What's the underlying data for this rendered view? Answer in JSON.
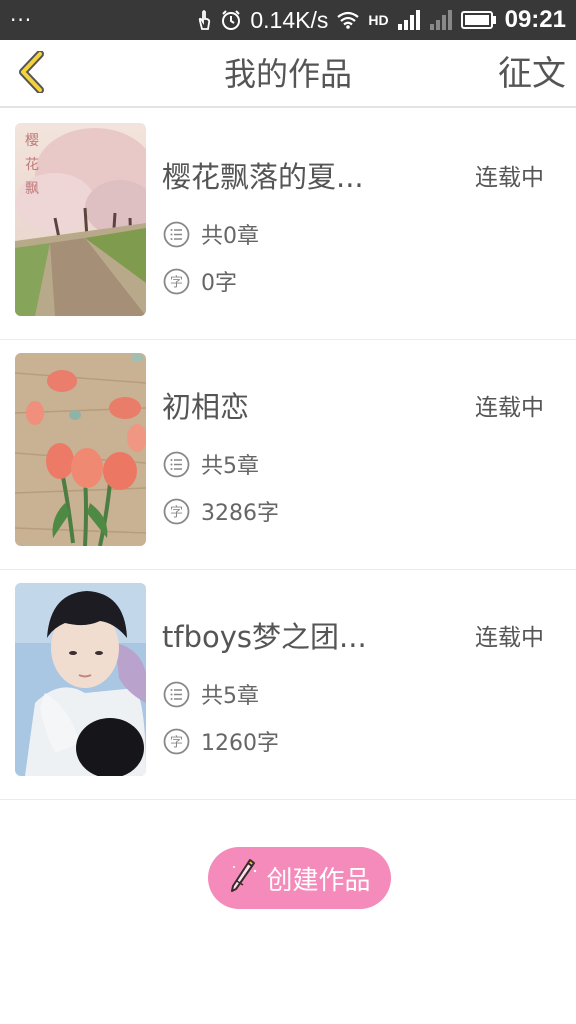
{
  "status_bar": {
    "left_text": "···",
    "speed": "0.14K/s",
    "network_type": "HD",
    "time": "09:21",
    "icons": [
      "hand-icon",
      "alarm-icon",
      "wifi-icon",
      "signal-icon",
      "signal-icon-2",
      "battery-icon"
    ]
  },
  "header": {
    "back_icon": "chevron-left-icon",
    "title": "我的作品",
    "action_label": "征文",
    "accent_color": "#f4d23c"
  },
  "works": [
    {
      "title": "樱花飘落的夏...",
      "status": "连载中",
      "chapters": "共0章",
      "words": "0字",
      "cover": "cherry-blossom-path"
    },
    {
      "title": "初相恋",
      "status": "连载中",
      "chapters": "共5章",
      "words": "3286字",
      "cover": "tulips-on-wood"
    },
    {
      "title": "tfboys梦之团...",
      "status": "连载中",
      "chapters": "共5章",
      "words": "1260字",
      "cover": "portrait-photo"
    }
  ],
  "create_button": {
    "label": "创建作品",
    "icon": "pencil-icon",
    "color": "#f58bbb"
  }
}
